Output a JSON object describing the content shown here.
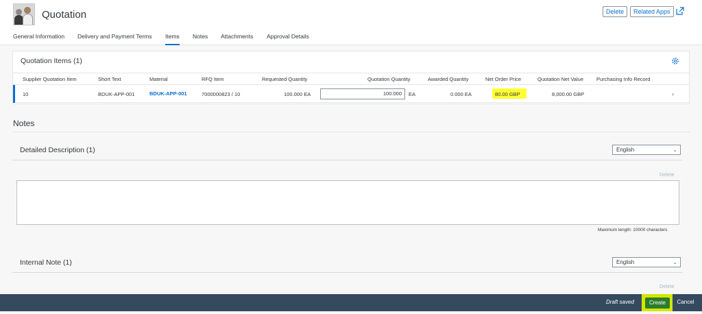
{
  "header": {
    "title": "Quotation",
    "delete_label": "Delete",
    "related_apps_label": "Related Apps"
  },
  "tabs": [
    {
      "label": "General Information"
    },
    {
      "label": "Delivery and Payment Terms"
    },
    {
      "label": "Items",
      "active": true
    },
    {
      "label": "Notes"
    },
    {
      "label": "Attachments"
    },
    {
      "label": "Approval Details"
    }
  ],
  "items": {
    "title": "Quotation Items (1)",
    "columns": [
      "Supplier Quotation Item",
      "Short Text",
      "Material",
      "RFQ Item",
      "Requested Quantity",
      "Quotation Quantity",
      "Awarded Quantity",
      "Net Order Price",
      "Quotation Net Value",
      "Purchasing Info Record"
    ],
    "row": {
      "item": "10",
      "short_text": "BDUK-APP-001",
      "material": "BDUK-APP-001",
      "rfq_item": "7000000823 / 10",
      "requested_qty": "100.000 EA",
      "quotation_qty": "100.000",
      "quotation_unit": "EA",
      "awarded_qty": "0.000 EA",
      "net_price": "80.00  GBP",
      "net_value": "8,000.00  GBP",
      "info_record": ""
    }
  },
  "notes": {
    "title": "Notes",
    "detailed": {
      "title": "Detailed Description (1)",
      "language": "English",
      "delete_label": "Delete",
      "text": "",
      "max_length": "Maximum length: 10000 characters"
    },
    "internal": {
      "title": "Internal Note (1)",
      "language": "English",
      "delete_label": "Delete"
    }
  },
  "footer": {
    "status": "Draft saved",
    "create_label": "Create",
    "cancel_label": "Cancel"
  },
  "colors": {
    "accent": "#0a6ed1",
    "footer_bg": "#354a5f",
    "highlight": "#ffff33",
    "create_bg": "#2b7c2b"
  }
}
